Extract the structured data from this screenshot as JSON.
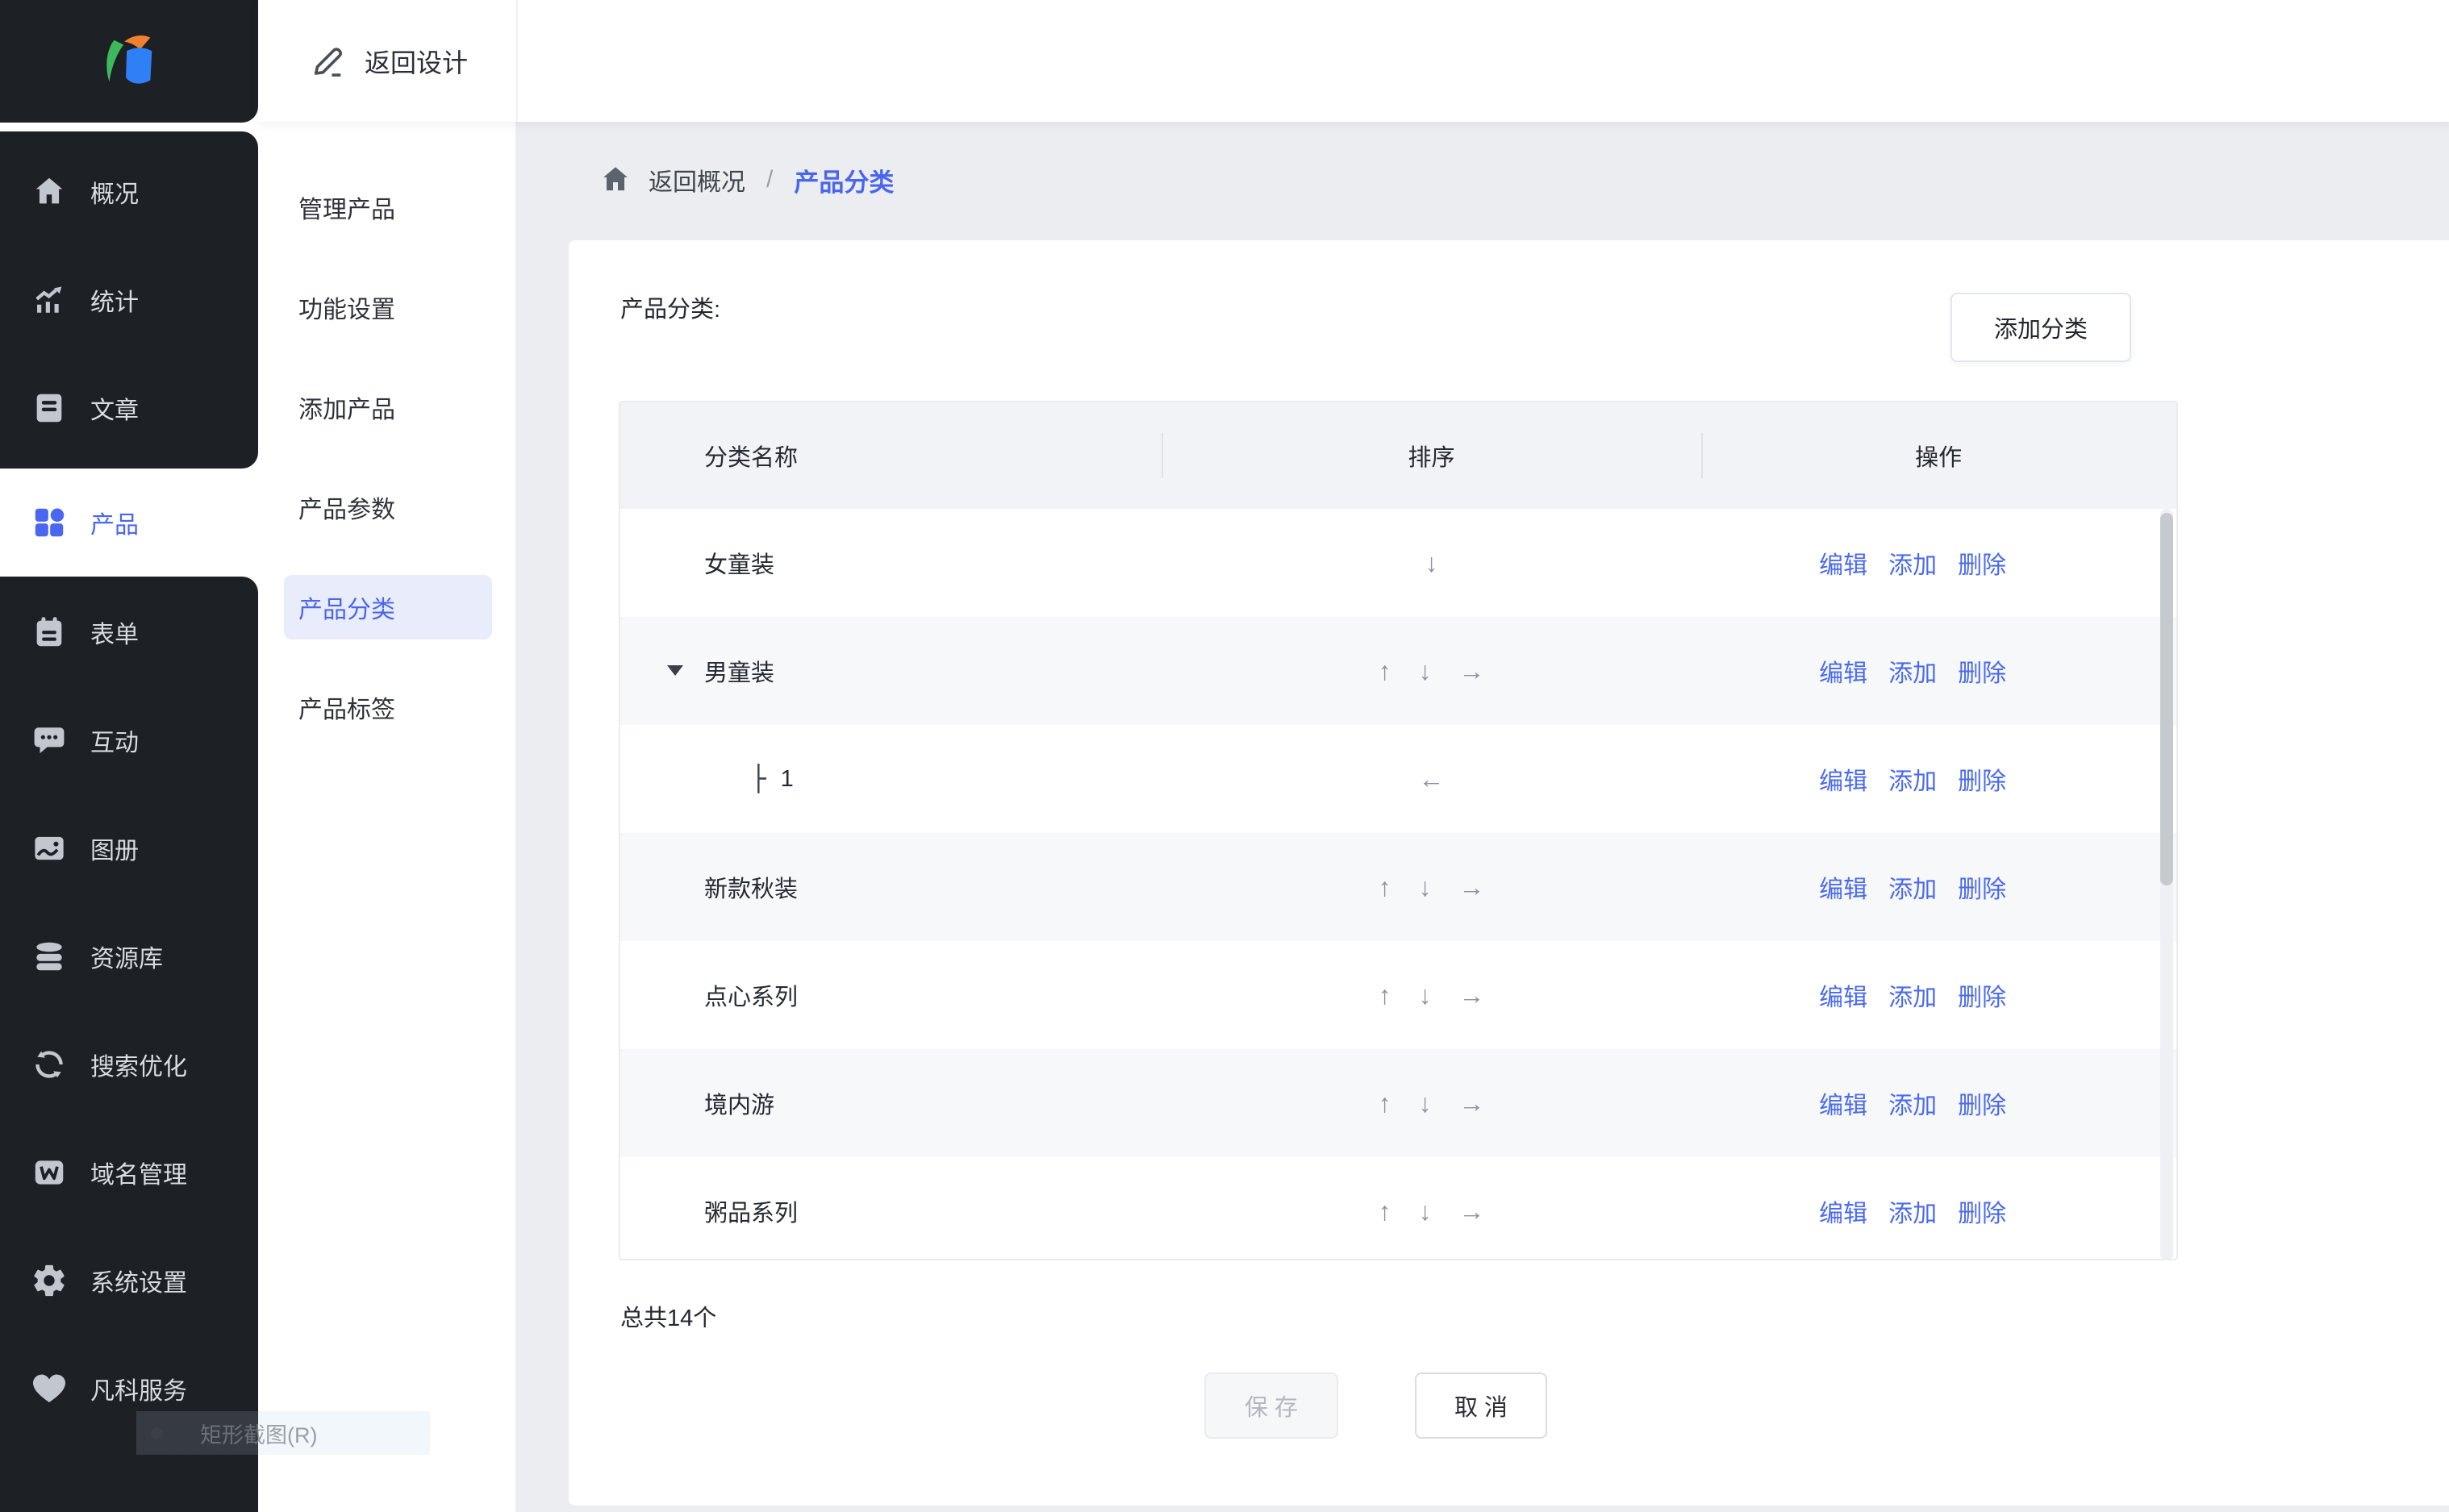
{
  "topbar": {
    "back_to_design": "返回设计"
  },
  "sidebar": {
    "items": [
      {
        "label": "概况",
        "icon": "home-icon"
      },
      {
        "label": "统计",
        "icon": "stats-icon"
      },
      {
        "label": "文章",
        "icon": "article-icon"
      },
      {
        "label": "产品",
        "icon": "products-icon",
        "active": true
      },
      {
        "label": "表单",
        "icon": "form-icon"
      },
      {
        "label": "互动",
        "icon": "interaction-icon"
      },
      {
        "label": "图册",
        "icon": "gallery-icon"
      },
      {
        "label": "资源库",
        "icon": "library-icon"
      },
      {
        "label": "搜索优化",
        "icon": "seo-icon"
      },
      {
        "label": "域名管理",
        "icon": "domain-icon"
      },
      {
        "label": "系统设置",
        "icon": "settings-icon"
      },
      {
        "label": "凡科服务",
        "icon": "service-icon"
      }
    ]
  },
  "submenu": {
    "items": [
      {
        "label": "管理产品"
      },
      {
        "label": "功能设置"
      },
      {
        "label": "添加产品"
      },
      {
        "label": "产品参数"
      },
      {
        "label": "产品分类",
        "active": true
      },
      {
        "label": "产品标签"
      }
    ]
  },
  "breadcrumb": {
    "back_label": "返回概况",
    "separator": "/",
    "current": "产品分类"
  },
  "content": {
    "section_label": "产品分类:",
    "add_button": "添加分类",
    "table": {
      "headers": [
        "分类名称",
        "排序",
        "操作"
      ],
      "action_labels": [
        "编辑",
        "添加",
        "删除"
      ],
      "sort_icons": {
        "up": "↑",
        "down": "↓",
        "right": "→",
        "left": "←"
      },
      "tree_branch_icon": "├",
      "rows": [
        {
          "name": "女童装",
          "level": 0,
          "sort": [
            "down"
          ]
        },
        {
          "name": "男童装",
          "level": 0,
          "expanded": true,
          "sort": [
            "up",
            "down",
            "right"
          ]
        },
        {
          "name": "1",
          "level": 1,
          "sort": [
            "left"
          ]
        },
        {
          "name": "新款秋装",
          "level": 0,
          "sort": [
            "up",
            "down",
            "right"
          ]
        },
        {
          "name": "点心系列",
          "level": 0,
          "sort": [
            "up",
            "down",
            "right"
          ]
        },
        {
          "name": "境内游",
          "level": 0,
          "sort": [
            "up",
            "down",
            "right"
          ]
        },
        {
          "name": "粥品系列",
          "level": 0,
          "sort": [
            "up",
            "down",
            "right"
          ]
        }
      ]
    },
    "total_text": "总共14个",
    "save_button": "保 存",
    "cancel_button": "取 消"
  },
  "overlay": {
    "screenshot_tooltip": "矩形截图(R)"
  },
  "colors": {
    "accent_blue": "#4b66ee",
    "link_blue": "#4a6af0",
    "rail_bg": "#1d2025",
    "submenu_active_bg": "#e9edfb",
    "page_bg": "#ebedf0",
    "table_header_bg": "#f2f3f6",
    "zebra_row_bg": "#f7f8fa",
    "logo_green": "#3cb95c",
    "logo_orange": "#f07f2e",
    "logo_blue": "#2f7ff7"
  }
}
